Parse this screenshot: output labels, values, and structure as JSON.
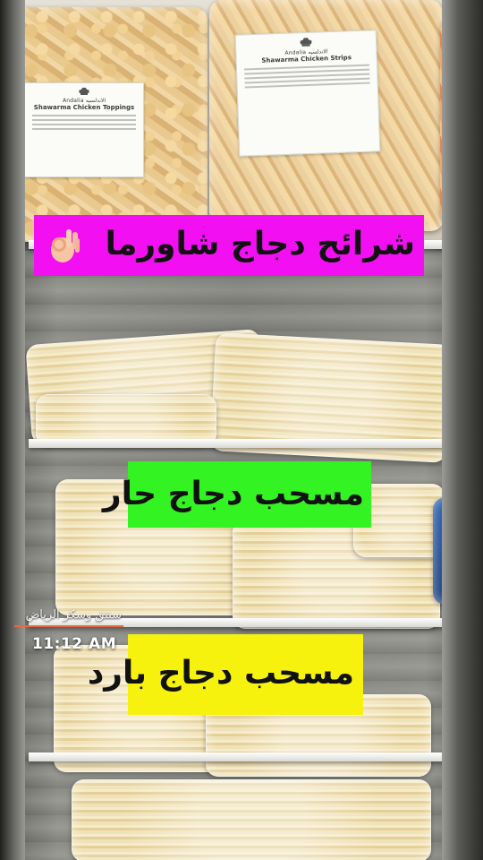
{
  "captions": {
    "top": "شرائح دجاج شاورما",
    "top_emoji": "ok-hand-emoji",
    "middle": "مسحب دجاج حار",
    "bottom": "مسحب دجاج بارد"
  },
  "caption_colors": {
    "top": "#f20ff2",
    "middle": "#33f322",
    "bottom": "#f6f20e"
  },
  "overlay": {
    "location": "سنتق وسكر الرياض",
    "time": "11:12 AM"
  },
  "product_labels": {
    "left": {
      "brand": "Andalia الاندلسيه",
      "product": "Shawarma Chicken Toppings"
    },
    "right": {
      "brand": "Andalia الاندلسيه",
      "product": "Shawarma Chicken Strips"
    }
  }
}
